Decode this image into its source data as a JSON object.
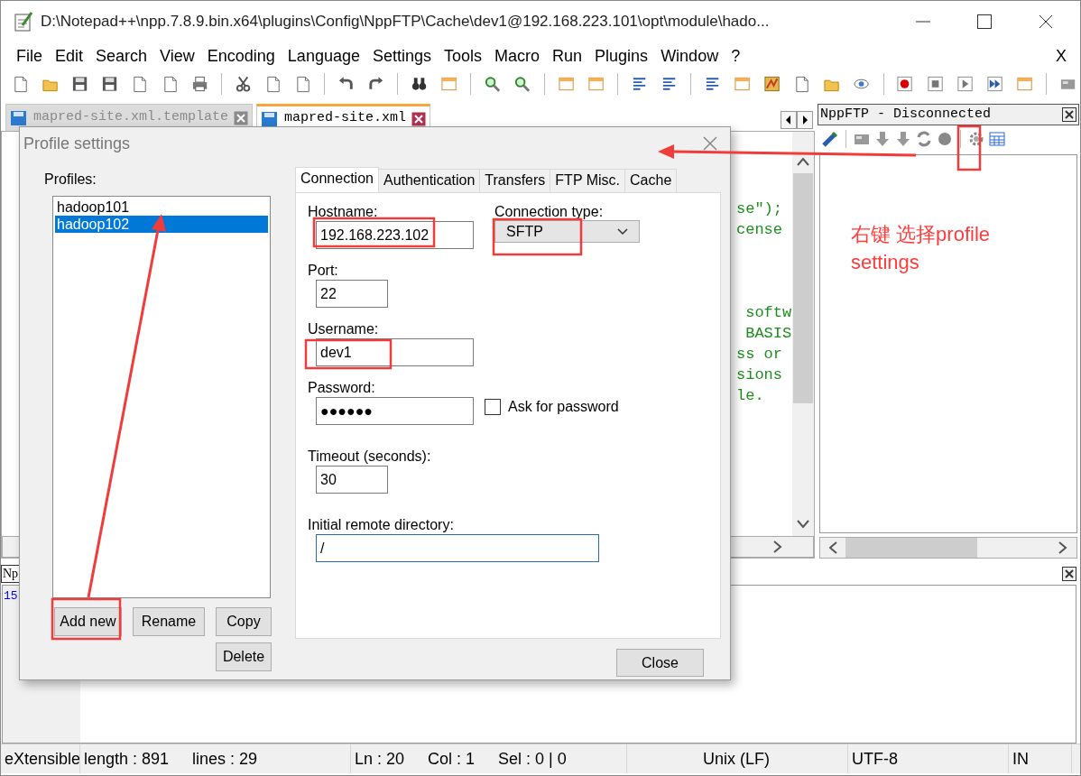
{
  "window": {
    "title": "D:\\Notepad++\\npp.7.8.9.bin.x64\\plugins\\Config\\NppFTP\\Cache\\dev1@192.168.223.101\\opt\\module\\hado..."
  },
  "menu": [
    "File",
    "Edit",
    "Search",
    "View",
    "Encoding",
    "Language",
    "Settings",
    "Tools",
    "Macro",
    "Run",
    "Plugins",
    "Window",
    "?"
  ],
  "menu_close": "X",
  "editor_tabs": [
    {
      "label": "mapred-site.xml.template",
      "selected": false
    },
    {
      "label": "mapred-site.xml",
      "selected": true
    }
  ],
  "code_lines": [
    "se\");",
    "cense",
    " softw",
    " BASIS",
    "ss or",
    "sions",
    "le."
  ],
  "ftp_panel": {
    "title": "NppFTP - Disconnected"
  },
  "annotation": "右键 选择profile settings",
  "bottom_panel": {
    "title": "Np",
    "line_numbers": [
      "15"
    ]
  },
  "dialog": {
    "title": "Profile settings",
    "profiles_label": "Profiles:",
    "profiles": [
      {
        "name": "hadoop101",
        "selected": false
      },
      {
        "name": "hadoop102",
        "selected": true
      }
    ],
    "profile_buttons": [
      "Add new",
      "Rename",
      "Copy",
      "Delete"
    ],
    "tabs": [
      {
        "label": "Connection",
        "selected": true
      },
      {
        "label": "Authentication",
        "selected": false
      },
      {
        "label": "Transfers",
        "selected": false
      },
      {
        "label": "FTP Misc.",
        "selected": false
      },
      {
        "label": "Cache",
        "selected": false
      }
    ],
    "hostname": {
      "label": "Hostname:",
      "value": "192.168.223.102"
    },
    "connection_type": {
      "label": "Connection type:",
      "value": "SFTP"
    },
    "port": {
      "label": "Port:",
      "value": "22"
    },
    "username": {
      "label": "Username:",
      "value": "dev1"
    },
    "password": {
      "label": "Password:",
      "value": "●●●●●●"
    },
    "ask_password": {
      "label": "Ask for password",
      "checked": false
    },
    "timeout": {
      "label": "Timeout (seconds):",
      "value": "30"
    },
    "remote_dir": {
      "label": "Initial remote directory:",
      "value": "/"
    },
    "close_button": "Close"
  },
  "status_bar": [
    [
      "eXtensible"
    ],
    [
      "length : 891",
      "lines : 29"
    ],
    [
      "Ln : 20",
      "Col : 1",
      "Sel : 0 | 0"
    ],
    [
      "Unix (LF)"
    ],
    [
      "UTF-8"
    ],
    [
      "IN"
    ]
  ]
}
